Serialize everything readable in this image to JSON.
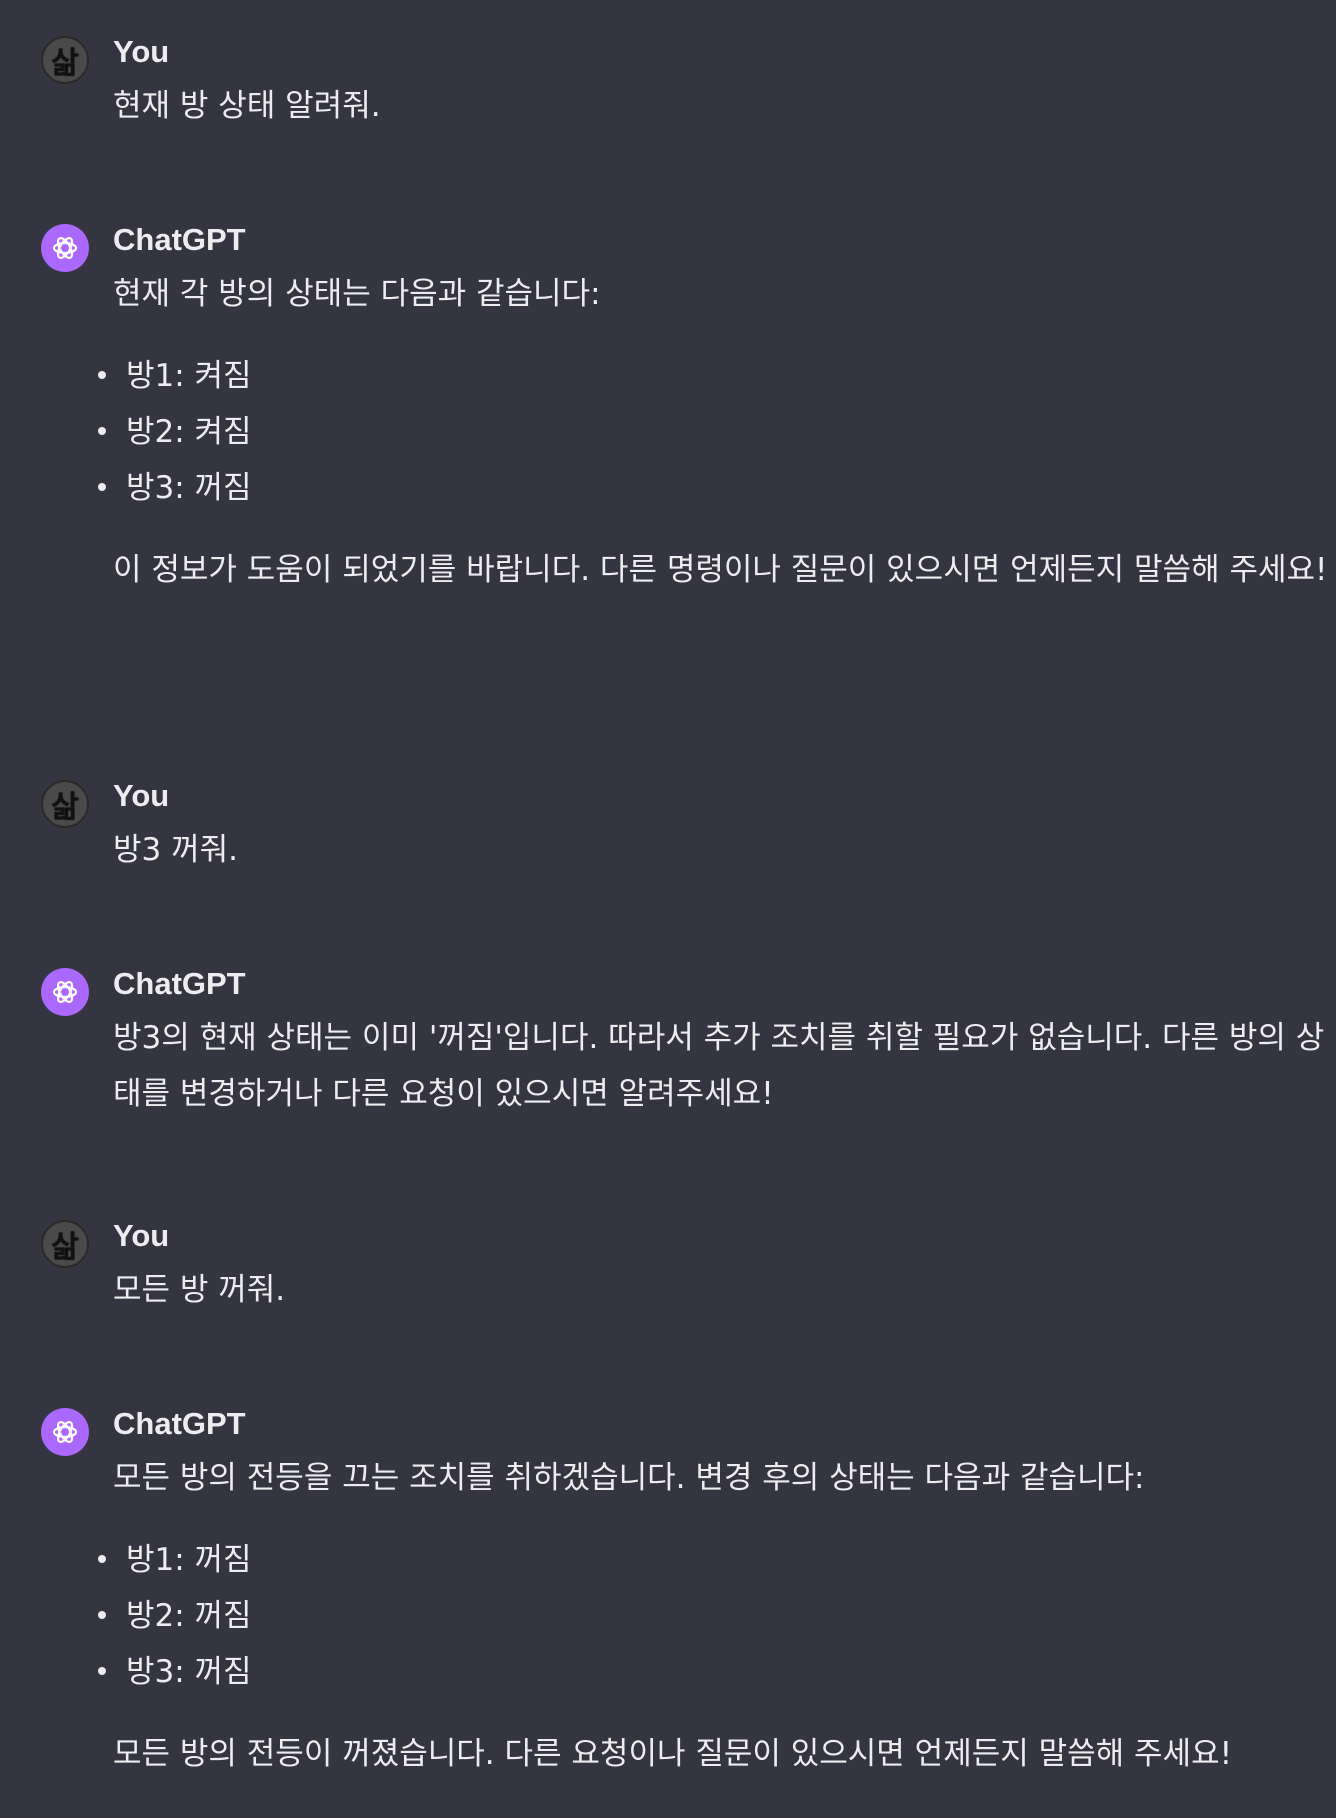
{
  "messages": [
    {
      "role": "user",
      "author": "You",
      "avatar_icon": "user-avatar-icon",
      "text": "현재 방 상태 알려줘."
    },
    {
      "role": "assistant",
      "author": "ChatGPT",
      "avatar_icon": "openai-logo-icon",
      "intro": "현재 각 방의 상태는 다음과 같습니다:",
      "items": [
        "방1: 켜짐",
        "방2: 켜짐",
        "방3: 꺼짐"
      ],
      "outro": "이 정보가 도움이 되었기를 바랍니다. 다른 명령이나 질문이 있으시면 언제든지 말씀해 주세요!"
    },
    {
      "role": "user",
      "author": "You",
      "avatar_icon": "user-avatar-icon",
      "text": "방3 꺼줘."
    },
    {
      "role": "assistant",
      "author": "ChatGPT",
      "avatar_icon": "openai-logo-icon",
      "text": "방3의 현재 상태는 이미 '꺼짐'입니다. 따라서 추가 조치를 취할 필요가 없습니다. 다른 방의 상태를 변경하거나 다른 요청이 있으시면 알려주세요!"
    },
    {
      "role": "user",
      "author": "You",
      "avatar_icon": "user-avatar-icon",
      "text": "모든 방 꺼줘."
    },
    {
      "role": "assistant",
      "author": "ChatGPT",
      "avatar_icon": "openai-logo-icon",
      "intro": "모든 방의 전등을 끄는 조치를 취하겠습니다. 변경 후의 상태는 다음과 같습니다:",
      "items": [
        "방1: 꺼짐",
        "방2: 꺼짐",
        "방3: 꺼짐"
      ],
      "outro": "모든 방의 전등이 꺼졌습니다. 다른 요청이나 질문이 있으시면 언제든지 말씀해 주세요!"
    }
  ],
  "colors": {
    "background": "#343541",
    "text": "#ececf1",
    "assistant_avatar": "#ab68ff"
  }
}
